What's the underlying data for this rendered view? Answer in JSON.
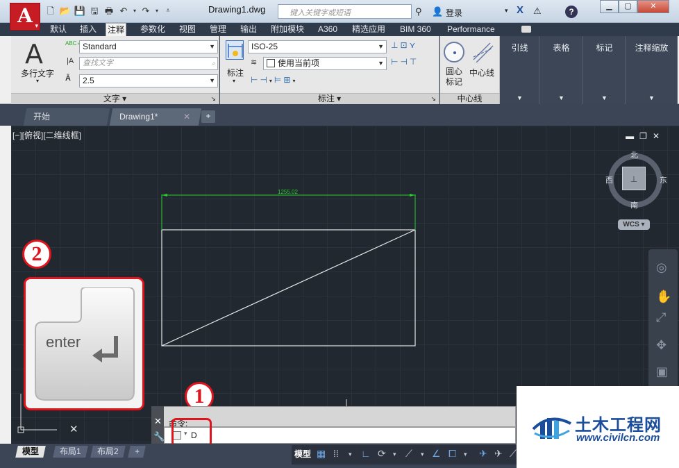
{
  "app": {
    "logo_letter": "A",
    "document_title": "Drawing1.dwg",
    "search_placeholder": "键入关键字或短语",
    "login": "登录"
  },
  "ribbon_tabs": [
    "默认",
    "插入",
    "注释",
    "参数化",
    "视图",
    "管理",
    "输出",
    "附加模块",
    "A360",
    "精选应用",
    "BIM 360",
    "Performance"
  ],
  "ribbon_active_tab": "注释",
  "ribbon": {
    "text_panel": {
      "title": "文字",
      "mtext_label": "多行文字",
      "style_value": "Standard",
      "find_placeholder": "查找文字",
      "height_value": "2.5"
    },
    "dim_panel": {
      "title": "标注",
      "dim_label": "标注",
      "style_value": "ISO-25",
      "layer_value": "使用当前项"
    },
    "centerline_panel": {
      "title": "中心线",
      "center_mark_label": "圆心\n标记",
      "centerline_label": "中心线"
    },
    "dark_panels": [
      "引线",
      "表格",
      "标记",
      "注释缩放"
    ]
  },
  "doc_tabs": {
    "start": "开始",
    "drawing": "Drawing1*"
  },
  "viewport": {
    "label": "[−][俯视][二维线框]",
    "dimension_value": "1255.02",
    "compass": {
      "north": "北",
      "south": "南",
      "east": "东",
      "west": "西",
      "wcs": "WCS"
    }
  },
  "annotations": {
    "badge_1": "1",
    "badge_2": "2",
    "enter_key_label": "enter"
  },
  "command_line": {
    "prompt_label": "命令:",
    "input_value": "D"
  },
  "layout_tabs": [
    "模型",
    "布局1",
    "布局2"
  ],
  "status_bar": {
    "model_label": "模型"
  },
  "watermark": {
    "title": "土木工程网",
    "url": "www.civilcn.com"
  },
  "colors": {
    "accent_red": "#e0141c",
    "dimension_green": "#2bd12b",
    "canvas_bg": "#212830",
    "watermark_blue": "#1a4d9c"
  }
}
